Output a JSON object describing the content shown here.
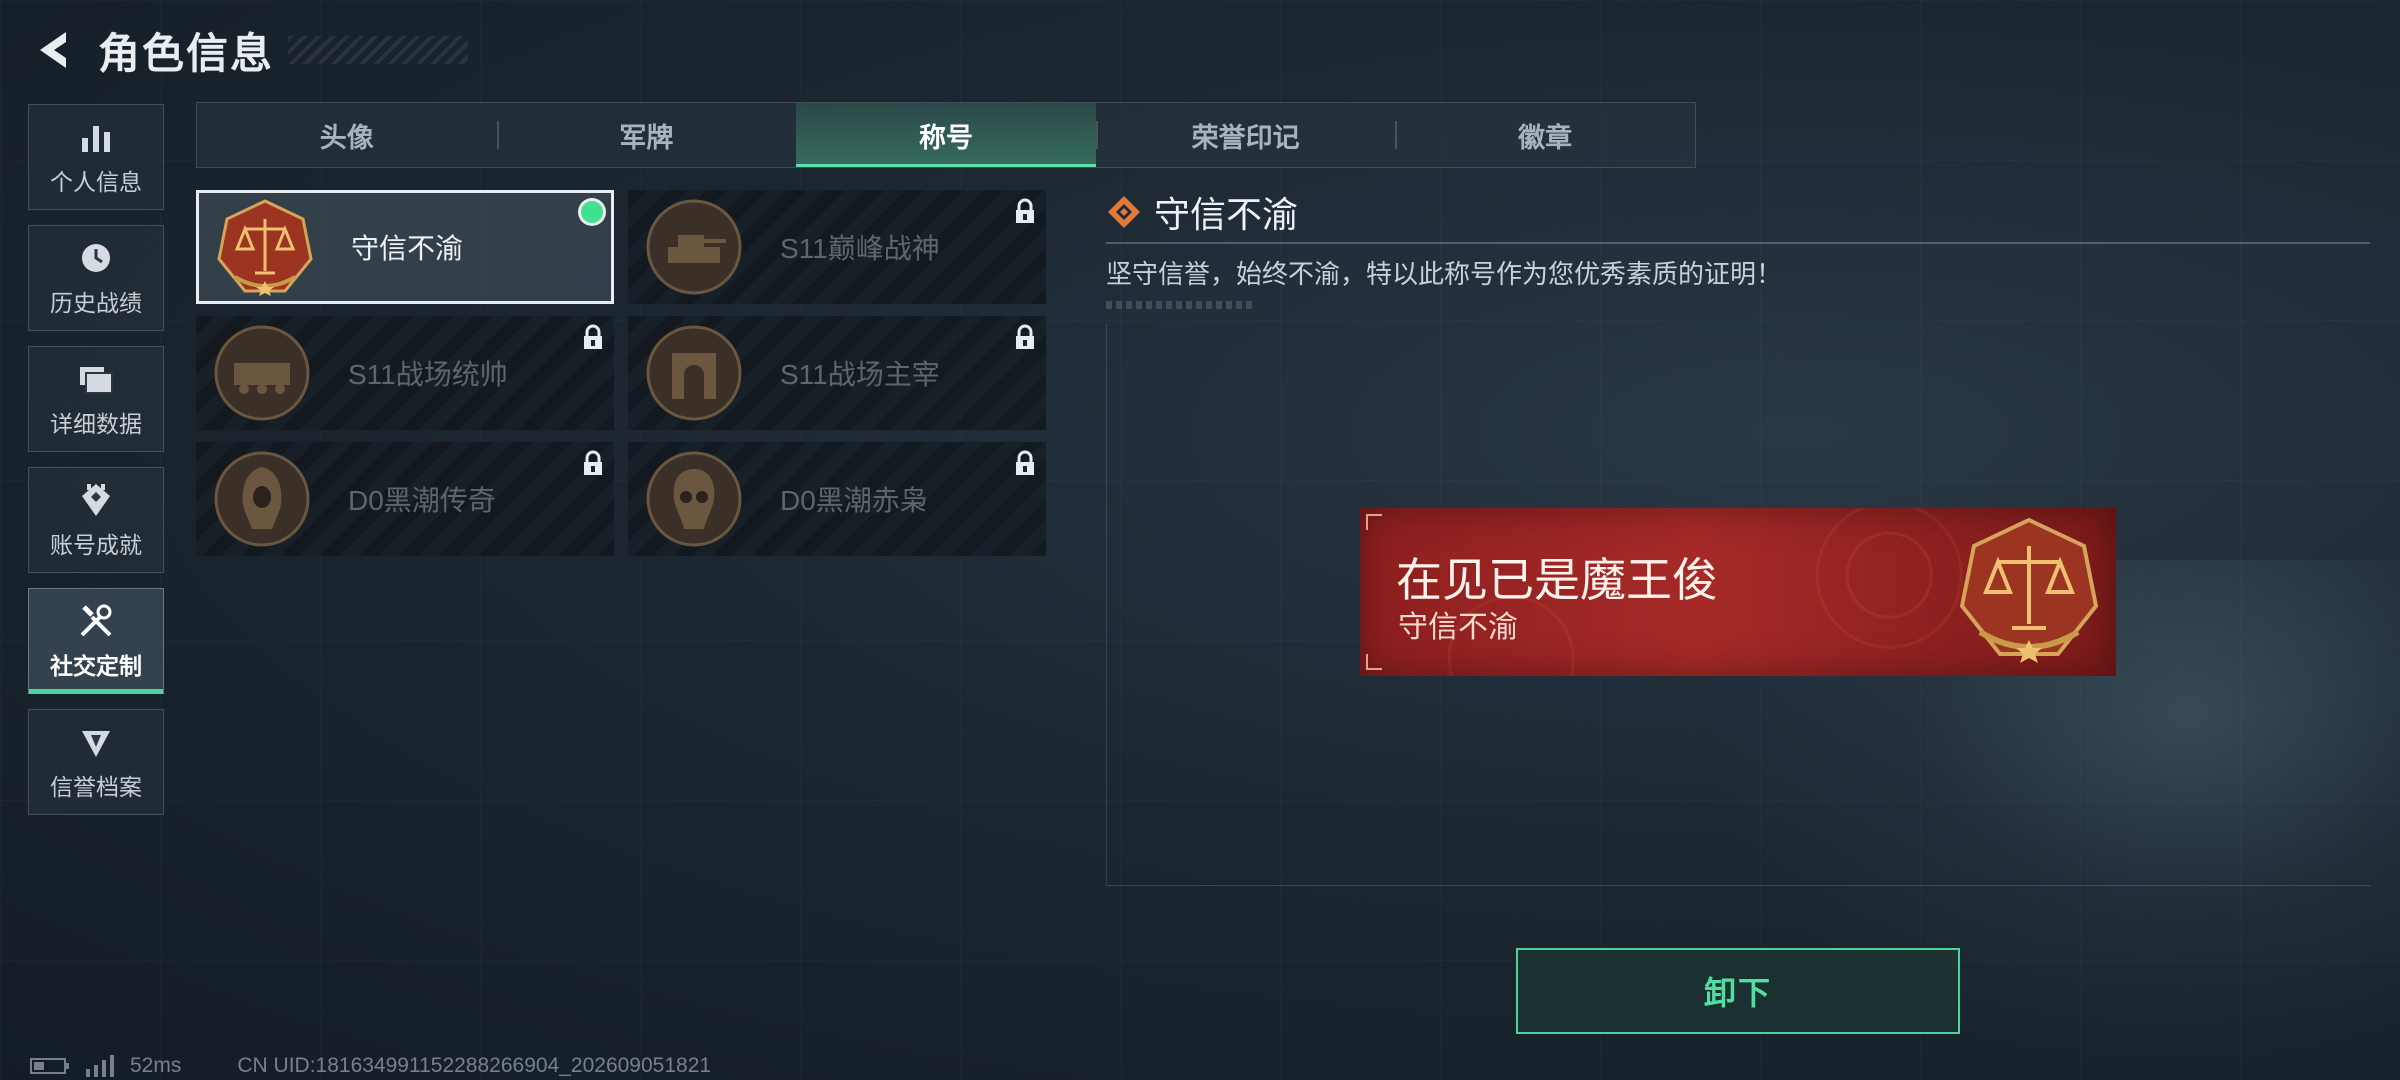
{
  "header": {
    "title": "角色信息"
  },
  "sidebar": {
    "items": [
      {
        "label": "个人信息",
        "icon": "bar-chart-icon"
      },
      {
        "label": "历史战绩",
        "icon": "clock-icon"
      },
      {
        "label": "详细数据",
        "icon": "folder-icon"
      },
      {
        "label": "账号成就",
        "icon": "achievement-icon"
      },
      {
        "label": "社交定制",
        "icon": "tools-icon",
        "active": true
      },
      {
        "label": "信誉档案",
        "icon": "credit-icon"
      }
    ]
  },
  "tabs": [
    {
      "label": "头像"
    },
    {
      "label": "军牌"
    },
    {
      "label": "称号",
      "active": true
    },
    {
      "label": "荣誉印记"
    },
    {
      "label": "徽章"
    }
  ],
  "titles": [
    {
      "name": "守信不渝",
      "equipped": true,
      "locked": false,
      "icon": "scales-badge-icon"
    },
    {
      "name": "S11巅峰战神",
      "locked": true,
      "icon": "tank-badge-icon"
    },
    {
      "name": "S11战场统帅",
      "locked": true,
      "icon": "apc-badge-icon"
    },
    {
      "name": "S11战场主宰",
      "locked": true,
      "icon": "arch-badge-icon"
    },
    {
      "name": "D0黑潮传奇",
      "locked": true,
      "icon": "hooded-figure-badge-icon"
    },
    {
      "name": "D0黑潮赤枭",
      "locked": true,
      "icon": "skull-badge-icon"
    }
  ],
  "detail": {
    "title": "守信不渝",
    "description": "坚守信誉，始终不渝，特以此称号作为您优秀素质的证明！"
  },
  "nameplate": {
    "player_name": "在见已是魔王俊",
    "title": "守信不渝"
  },
  "actions": {
    "unequip_label": "卸下"
  },
  "status": {
    "ping": "52ms",
    "uid": "CN UID:18163499115228826690​4_202609051821"
  },
  "colors": {
    "accent": "#4fd39a",
    "nameplate_red": "#a52a27",
    "detail_icon": "#e07a3c"
  }
}
